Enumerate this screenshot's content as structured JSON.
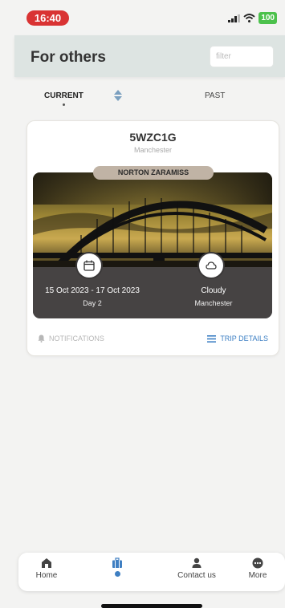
{
  "status_bar": {
    "time": "16:40",
    "battery": "100"
  },
  "header": {
    "title": "For others",
    "filter_placeholder": "filter"
  },
  "tabs": {
    "current": "CURRENT",
    "past": "PAST"
  },
  "trip": {
    "code": "5WZC1G",
    "city": "Manchester",
    "traveler": "NORTON ZARAMISS",
    "dates": "15 Oct 2023 - 17 Oct 2023",
    "day": "Day 2",
    "weather": "Cloudy",
    "weather_city": "Manchester",
    "notifications_label": "NOTIFICATIONS",
    "trip_details_label": "TRIP DETAILS"
  },
  "bottom_nav": {
    "home": "Home",
    "contact": "Contact us",
    "more": "More",
    "active_color": "#3f7fc2"
  },
  "colors": {
    "status_pill": "#d93333",
    "accent": "#3e80c4",
    "header_bg": "#dde4e2"
  }
}
